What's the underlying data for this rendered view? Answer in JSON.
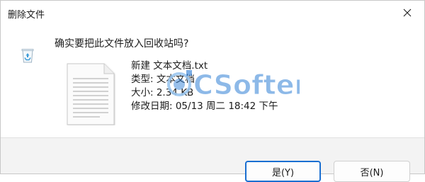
{
  "window": {
    "title": "删除文件",
    "close_icon": "close-icon"
  },
  "dialog": {
    "question": "确实要把此文件放入回收站吗?",
    "prompt_icon": "recycle-bin-icon",
    "file_icon": "text-document-icon"
  },
  "file": {
    "name": "新建 文本文档.txt",
    "type": "类型: 文本文档",
    "size": "大小: 2.34 KB",
    "modified": "修改日期: 05/13 周二 18:42 下午"
  },
  "watermark": {
    "text": "CSofter",
    "logo_icon": "csofter-logo-icon",
    "colors": {
      "primary": "#2f7fd6",
      "secondary": "#9bc6ef"
    }
  },
  "buttons": {
    "yes_label": "是(Y)",
    "no_label": "否(N)"
  },
  "colors": {
    "focus_border": "#1a6fd1",
    "footer_bg": "#f3f3f3"
  }
}
